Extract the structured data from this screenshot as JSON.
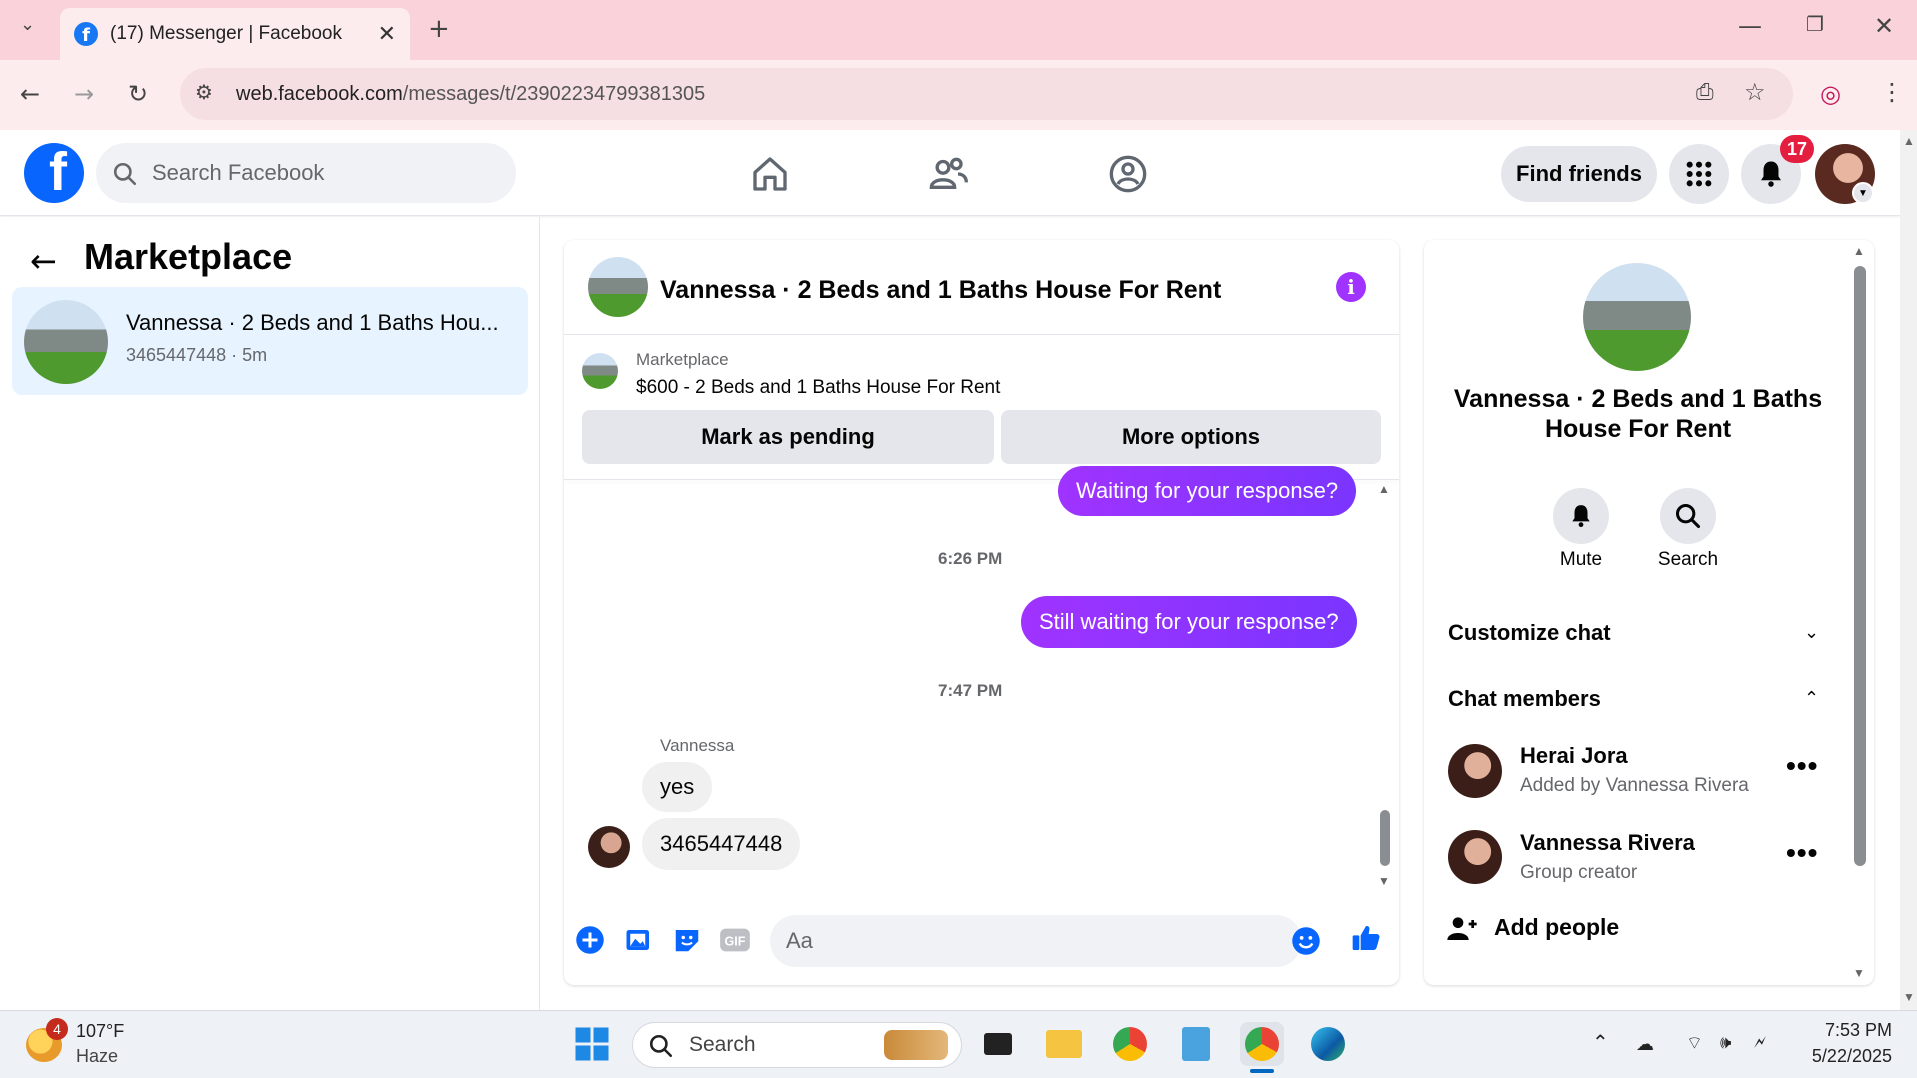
{
  "browser": {
    "tab_title": "(17) Messenger | Facebook",
    "url_host": "web.facebook.com",
    "url_path": "/messages/t/23902234799381305"
  },
  "fb": {
    "search_placeholder": "Search Facebook",
    "find_friends": "Find friends",
    "notification_count": "17"
  },
  "left": {
    "title": "Marketplace",
    "conversations": [
      {
        "title": "Vannessa · 2 Beds and 1 Baths Hou...",
        "subtitle": "3465447448 · 5m"
      }
    ]
  },
  "chat": {
    "title": "Vannessa · 2 Beds and 1 Baths House For Rent",
    "listing_label": "Marketplace",
    "listing_price": "$600 - 2 Beds and 1 Baths House For Rent",
    "mark_pending": "Mark as pending",
    "more_options": "More options",
    "messages": {
      "out1": "Waiting for your response?",
      "time1": "6:26 PM",
      "out2": "Still waiting for your response?",
      "time2": "7:47 PM",
      "sender": "Vannessa",
      "in1": "yes",
      "in2": "3465447448"
    },
    "composer_placeholder": "Aa"
  },
  "info": {
    "title": "Vannessa · 2 Beds and 1 Baths House For Rent",
    "mute": "Mute",
    "search": "Search",
    "customize": "Customize chat",
    "members_heading": "Chat members",
    "members": [
      {
        "name": "Herai Jora",
        "sub": "Added by Vannessa Rivera"
      },
      {
        "name": "Vannessa Rivera",
        "sub": "Group creator"
      }
    ],
    "add_people": "Add people"
  },
  "taskbar": {
    "weather_badge": "4",
    "temp": "107°F",
    "condition": "Haze",
    "search": "Search",
    "time": "7:53 PM",
    "date": "5/22/2025"
  },
  "colors": {
    "fb_blue": "#0866ff",
    "messenger_purple": "#a033ff",
    "selected_bg": "#e7f3ff",
    "tab_strip": "#f9d3d9"
  }
}
